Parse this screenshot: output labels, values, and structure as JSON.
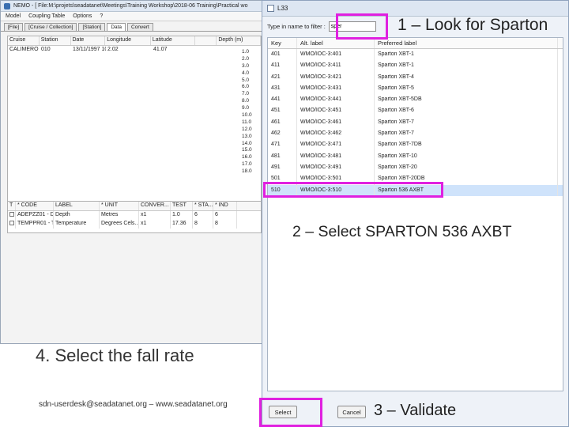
{
  "nemo": {
    "title": "NEMO - [ File:M:\\projets\\seadatanet\\Meetings\\Training Workshop\\2018-06 Training\\Practical wo",
    "menu": [
      "Model",
      "Coupling Table",
      "Options",
      "?"
    ],
    "tabs": [
      "[File]",
      "[Cruise / Collection]",
      "[Station]",
      "Data",
      "Convert"
    ],
    "data_table": {
      "headers": [
        "Cruise",
        "Station",
        "Date",
        "Longitude",
        "Latitude",
        "Depth (m)"
      ],
      "first_row": [
        "CALIMERO",
        "010",
        "13/11/1997 10...",
        "2.02",
        "41.07"
      ],
      "depths": [
        "1.0",
        "2.0",
        "3.0",
        "4.0",
        "5.0",
        "6.0",
        "7.0",
        "8.0",
        "9.0",
        "10.0",
        "11.0",
        "12.0",
        "13.0",
        "14.0",
        "15.0",
        "16.0",
        "17.0",
        "18.0"
      ]
    },
    "param_table": {
      "headers": [
        "T",
        "* CODE",
        "LABEL",
        "* UNIT",
        "CONVER...",
        "TEST",
        "* STA...",
        "* IND"
      ],
      "rows": [
        [
          "ADEPZZ01 - D...",
          "Depth",
          "Metres",
          "x1",
          "1.0",
          "6",
          "6"
        ],
        [
          "TEMPPR01 - T...",
          "Temperature",
          "Degrees Cels...",
          "x1",
          "17.36",
          "8",
          "8"
        ]
      ]
    }
  },
  "dialog": {
    "title": "L33",
    "filter_label": "Type in name to filter :",
    "filter_value": "sper",
    "columns": [
      "Key",
      "Alt. label",
      "Preferred label"
    ],
    "rows": [
      {
        "key": "401",
        "alt": "WMO/IOC-3:401",
        "pref": "Sparton XBT-1"
      },
      {
        "key": "411",
        "alt": "WMO/IOC-3:411",
        "pref": "Sparton XBT-1"
      },
      {
        "key": "421",
        "alt": "WMO/IOC-3:421",
        "pref": "Sparton XBT-4"
      },
      {
        "key": "431",
        "alt": "WMO/IOC-3:431",
        "pref": "Sparton XBT-5"
      },
      {
        "key": "441",
        "alt": "WMO/IOC-3:441",
        "pref": "Sparton XBT-5DB"
      },
      {
        "key": "451",
        "alt": "WMO/IOC-3:451",
        "pref": "Sparton XBT-6"
      },
      {
        "key": "461",
        "alt": "WMO/IOC-3:461",
        "pref": "Sparton XBT-7"
      },
      {
        "key": "462",
        "alt": "WMO/IOC-3:462",
        "pref": "Sparton XBT-7"
      },
      {
        "key": "471",
        "alt": "WMO/IOC-3:471",
        "pref": "Sparton XBT-7DB"
      },
      {
        "key": "481",
        "alt": "WMO/IOC-3:481",
        "pref": "Sparton XBT-10"
      },
      {
        "key": "491",
        "alt": "WMO/IOC-3:491",
        "pref": "Sparton XBT-20"
      },
      {
        "key": "501",
        "alt": "WMO/IOC-3:501",
        "pref": "Sparton XBT-20DB"
      },
      {
        "key": "510",
        "alt": "WMO/IOC-3:510",
        "pref": "Sparton 536 AXBT"
      }
    ],
    "selected_key": "510",
    "select_label": "Select",
    "cancel_label": "Cancel"
  },
  "annotations": {
    "step1": "1 – Look for Sparton",
    "step2": "2 – Select SPARTON 536 AXBT",
    "step3": "3 – Validate",
    "step4": "4. Select the fall rate",
    "footer": "sdn-userdesk@seadatanet.org – www.seadatanet.org"
  },
  "colors": {
    "highlight": "#e020e0",
    "selection": "#cfe3fb"
  }
}
